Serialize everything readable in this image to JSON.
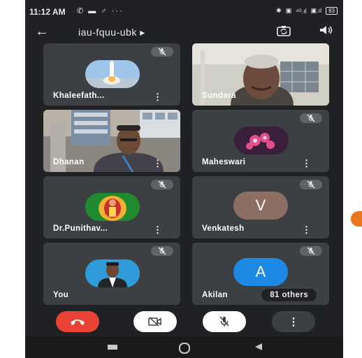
{
  "status_bar": {
    "time": "11:12 AM",
    "left_icons": "✆ ▬ ♂ ···",
    "right_icons": [
      "✱",
      "▣",
      "⁴ᴳ.ıl",
      "▣.ıl"
    ],
    "battery": "83"
  },
  "top_bar": {
    "meeting_code": "iau-fquu-ubk ▸"
  },
  "participants": [
    {
      "name": "Khaleefath...",
      "muted": true
    },
    {
      "name": "Sundara",
      "muted": false
    },
    {
      "name": "Dhanan",
      "muted": false
    },
    {
      "name": "Maheswari",
      "muted": true
    },
    {
      "name": "Dr.Punithav...",
      "muted": true
    },
    {
      "name": "Venkatesh",
      "avatar_letter": "V",
      "avatar_color": "#8d6e63",
      "muted": true
    },
    {
      "name": "You",
      "muted": true
    },
    {
      "name": "Akilan",
      "avatar_letter": "A",
      "avatar_color": "#1e88e5",
      "muted": true,
      "others_label": "81 others"
    }
  ],
  "controls": {
    "end_call_color": "#ea4335",
    "camera_state": "off",
    "mic_state": "muted"
  },
  "colors": {
    "background": "#202124",
    "tile": "#3c4043",
    "accent_orange": "#e8761f"
  }
}
